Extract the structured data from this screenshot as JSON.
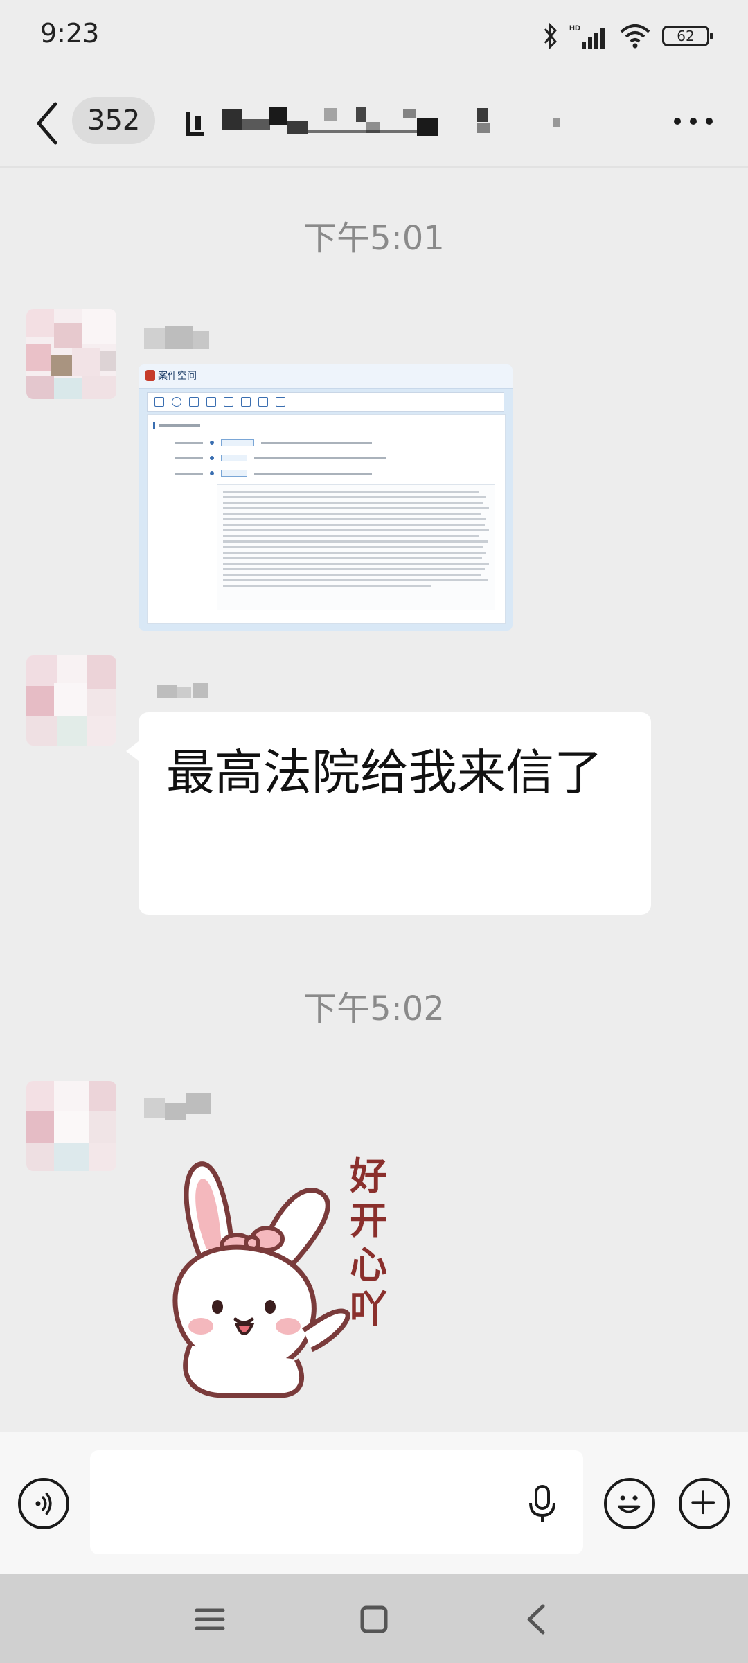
{
  "status_bar": {
    "time": "9:23",
    "battery": "62",
    "icons": [
      "bluetooth-icon",
      "hd-signal-icon",
      "wifi-icon",
      "battery-icon"
    ]
  },
  "header": {
    "unread_count": "352",
    "title": "",
    "icons": [
      "back-arrow-icon",
      "more-icon"
    ]
  },
  "messages": [
    {
      "timestamp": "下午5:01",
      "sender": "",
      "type": "image",
      "image": {
        "window_title": "案件空间",
        "toolbar_items": [
          "",
          "",
          "",
          "",
          "",
          "",
          "",
          ""
        ],
        "panel_title": "",
        "rows": [
          {
            "date": "",
            "tag": "",
            "text": ""
          },
          {
            "date": "",
            "tag": "",
            "text": ""
          },
          {
            "date": "",
            "tag": "",
            "text": ""
          }
        ]
      }
    },
    {
      "sender": "",
      "type": "text",
      "text": "最高法院给我来信了"
    },
    {
      "timestamp": "下午5:02",
      "sender": "",
      "type": "sticker",
      "sticker_text": "好开心吖",
      "sticker_icon": "bunny-sticker-icon"
    }
  ],
  "input_bar": {
    "placeholder": "",
    "icons": [
      "voice-toggle-icon",
      "microphone-icon",
      "emoji-icon",
      "plus-icon"
    ]
  },
  "nav_bar": {
    "icons": [
      "menu-icon",
      "home-icon",
      "nav-back-icon"
    ]
  },
  "colors": {
    "chat_background": "#ededed",
    "bubble": "#ffffff",
    "timestamp_text": "#8a8a8a",
    "sticker_text": "#8a2f2c"
  }
}
